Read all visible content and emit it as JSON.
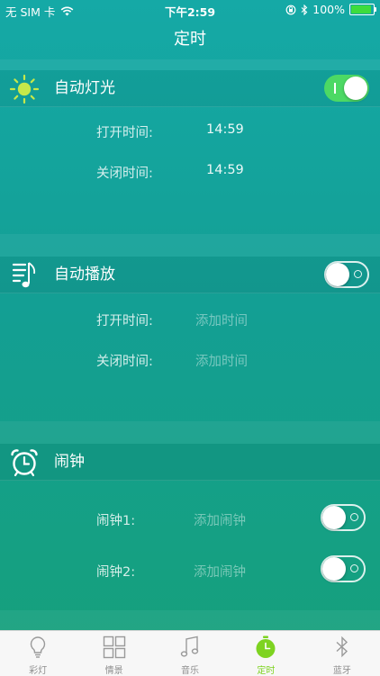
{
  "status_bar": {
    "carrier": "无 SIM 卡",
    "time": "下午2:59",
    "battery_percent": "100%",
    "battery_level": 1.0
  },
  "nav": {
    "title": "定时"
  },
  "auto_light": {
    "title": "自动灯光",
    "enabled": true,
    "open_label": "打开时间:",
    "open_value": "14:59",
    "close_label": "关闭时间:",
    "close_value": "14:59"
  },
  "auto_play": {
    "title": "自动播放",
    "enabled": false,
    "open_label": "打开时间:",
    "open_value": "添加时间",
    "close_label": "关闭时间:",
    "close_value": "添加时间"
  },
  "alarm": {
    "title": "闹钟",
    "items": [
      {
        "label": "闹钟1:",
        "value": "添加闹钟",
        "enabled": false
      },
      {
        "label": "闹钟2:",
        "value": "添加闹钟",
        "enabled": false
      }
    ]
  },
  "tab_bar": {
    "tabs": [
      {
        "label": "彩灯",
        "icon": "bulb-icon"
      },
      {
        "label": "情景",
        "icon": "grid-icon"
      },
      {
        "label": "音乐",
        "icon": "music-note-icon"
      },
      {
        "label": "定时",
        "icon": "timer-icon",
        "active": true
      },
      {
        "label": "蓝牙",
        "icon": "bluetooth-icon"
      }
    ]
  },
  "colors": {
    "accent_green": "#4cd964",
    "active_tab": "#7ed321",
    "sun_icon": "#c6e84a"
  }
}
